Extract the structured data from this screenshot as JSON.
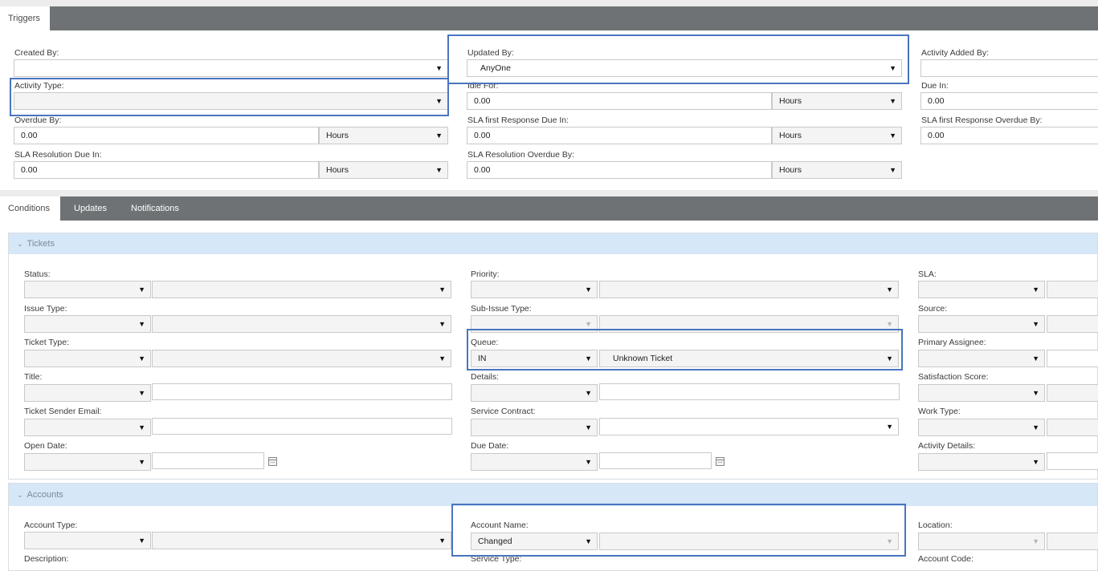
{
  "triggers_tab": "Triggers",
  "triggers": {
    "created_by": {
      "label": "Created By:",
      "value": ""
    },
    "updated_by": {
      "label": "Updated By:",
      "value": "AnyOne"
    },
    "activity_added_by": {
      "label": "Activity Added By:",
      "value": ""
    },
    "activity_type": {
      "label": "Activity Type:",
      "value": ""
    },
    "idle_for": {
      "label": "Idle For:",
      "value": "0.00",
      "unit": "Hours"
    },
    "due_in": {
      "label": "Due In:",
      "value": "0.00"
    },
    "overdue_by": {
      "label": "Overdue By:",
      "value": "0.00",
      "unit": "Hours"
    },
    "sla_first_response_due_in": {
      "label": "SLA first Response Due In:",
      "value": "0.00",
      "unit": "Hours"
    },
    "sla_first_response_overdue_by": {
      "label": "SLA first Response Overdue By:",
      "value": "0.00"
    },
    "sla_resolution_due_in": {
      "label": "SLA Resolution Due In:",
      "value": "0.00",
      "unit": "Hours"
    },
    "sla_resolution_overdue_by": {
      "label": "SLA Resolution Overdue By:",
      "value": "0.00",
      "unit": "Hours"
    }
  },
  "tabs": {
    "conditions": "Conditions",
    "updates": "Updates",
    "notifications": "Notifications"
  },
  "tickets": {
    "title": "Tickets",
    "status": "Status:",
    "priority": "Priority:",
    "sla": "SLA:",
    "issue_type": "Issue Type:",
    "sub_issue_type": "Sub-Issue Type:",
    "source": "Source:",
    "ticket_type": "Ticket Type:",
    "queue": {
      "label": "Queue:",
      "operator": "IN",
      "value": "Unknown Ticket"
    },
    "primary_assignee": "Primary Assignee:",
    "title_field": "Title:",
    "details": "Details:",
    "satisfaction_score": "Satisfaction Score:",
    "ticket_sender_email": "Ticket Sender Email:",
    "service_contract": "Service Contract:",
    "work_type": "Work Type:",
    "open_date": "Open Date:",
    "due_date": "Due Date:",
    "activity_details": "Activity Details:"
  },
  "accounts": {
    "title": "Accounts",
    "account_type": "Account Type:",
    "account_name": {
      "label": "Account Name:",
      "operator": "Changed"
    },
    "location": "Location:",
    "description": "Description:",
    "service_type": "Service Type:",
    "account_code": "Account Code:"
  },
  "colors": {
    "tabbar": "#6e7274",
    "section_header": "#d6e7f7",
    "highlight": "#4a75c0"
  }
}
